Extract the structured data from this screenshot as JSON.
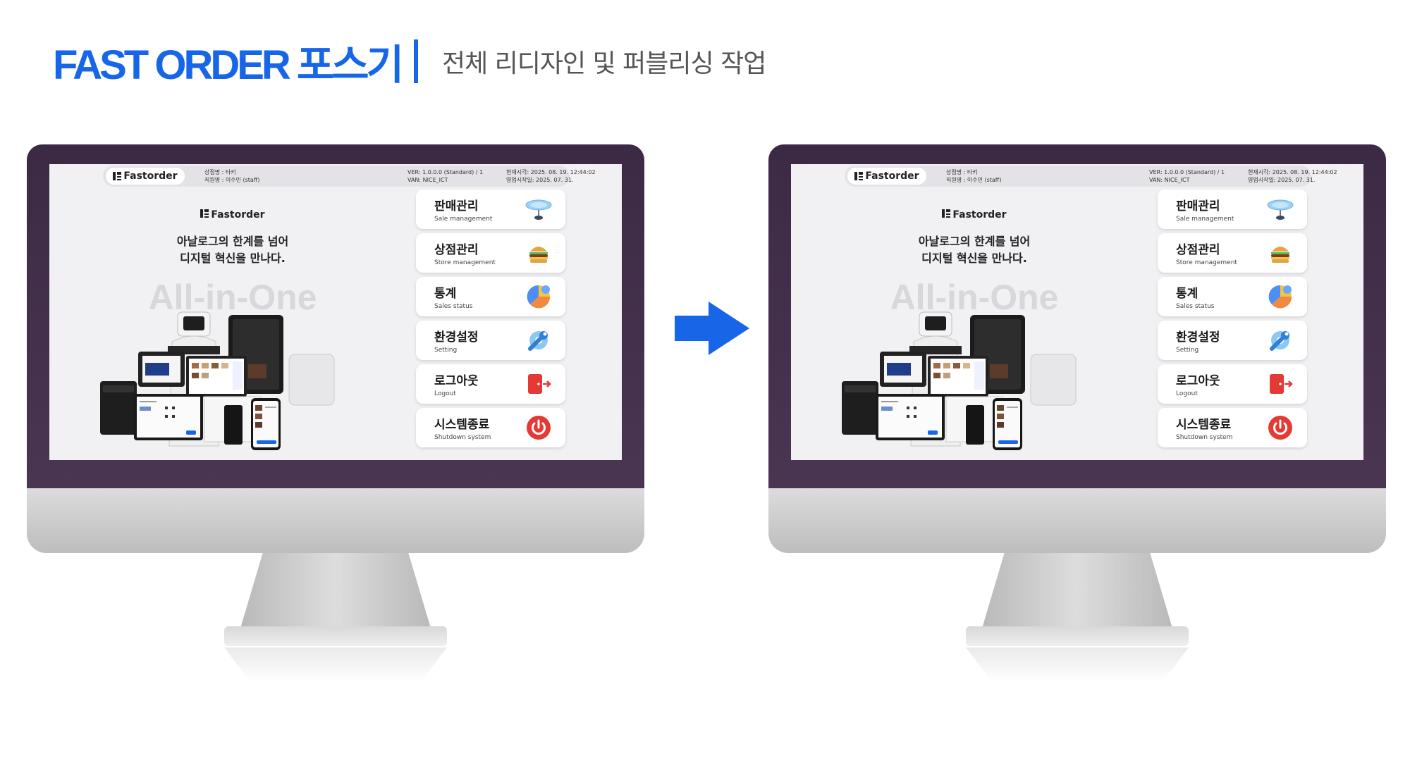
{
  "header": {
    "title": "FAST ORDER 포스기",
    "subtitle": "전체 리디자인 및 퍼블리싱 작업"
  },
  "pos": {
    "brand": "Fastorder",
    "info": {
      "store": "상점명 : 타키",
      "staff": "직원명 : 이수민 (staff)",
      "version": "VER: 1.0.0.0  (Standard) / 1",
      "van": "VAN: NICE_ICT",
      "current_time": "현재시각: 2025. 08. 19. 12:44:02",
      "open_date": "영업시작일: 2025. 07. 31."
    },
    "hero": {
      "line1": "아날로그의 한계를 넘어",
      "line2": "디지털 혁신을 만나다.",
      "watermark": "All-in-One"
    },
    "menu": [
      {
        "ko": "판매관리",
        "en": "Sale management",
        "icon": "hologram-disc-icon"
      },
      {
        "ko": "상점관리",
        "en": "Store management",
        "icon": "burger-icon"
      },
      {
        "ko": "통계",
        "en": "Sales status",
        "icon": "pie-chart-icon"
      },
      {
        "ko": "환경설정",
        "en": "Setting",
        "icon": "wrench-gear-icon"
      },
      {
        "ko": "로그아웃",
        "en": "Logout",
        "icon": "logout-door-icon"
      },
      {
        "ko": "시스템종료",
        "en": "Shutdown system",
        "icon": "power-icon"
      }
    ]
  },
  "colors": {
    "accent": "#1766e8",
    "bezel": "#3c2a44",
    "power": "#e53935"
  }
}
